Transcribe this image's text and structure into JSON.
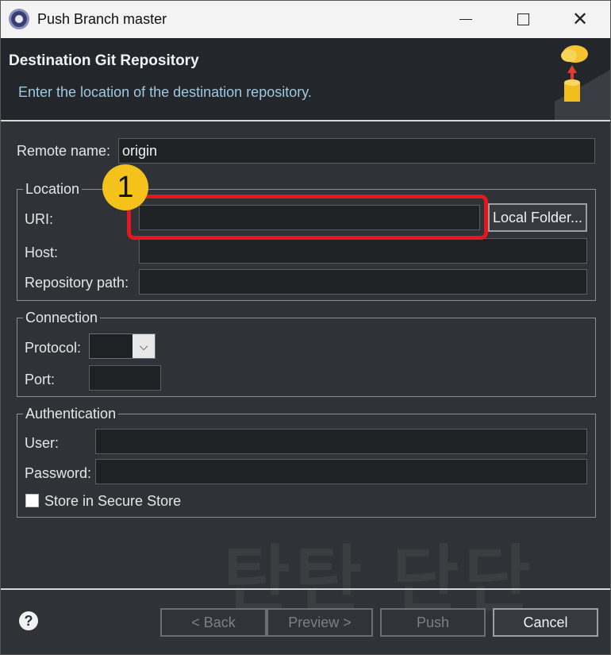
{
  "window": {
    "title": "Push Branch master",
    "minimize_icon": "minimize-icon",
    "maximize_icon": "maximize-icon",
    "close_glyph": "✕"
  },
  "banner": {
    "title": "Destination Git Repository",
    "description": "Enter the location of the destination repository."
  },
  "form": {
    "remote_name_label": "Remote name:",
    "remote_name_value": "origin"
  },
  "location": {
    "legend": "Location",
    "uri_label": "URI:",
    "uri_value": "",
    "local_folder_button": "Local Folder...",
    "host_label": "Host:",
    "host_value": "",
    "repo_path_label": "Repository path:",
    "repo_path_value": ""
  },
  "connection": {
    "legend": "Connection",
    "protocol_label": "Protocol:",
    "protocol_value": "",
    "port_label": "Port:",
    "port_value": ""
  },
  "authentication": {
    "legend": "Authentication",
    "user_label": "User:",
    "user_value": "",
    "password_label": "Password:",
    "password_value": "",
    "store_checkbox_label": "Store in Secure Store",
    "store_checked": false
  },
  "footer": {
    "help_glyph": "?",
    "back_button": "< Back",
    "preview_button": "Preview >",
    "push_button": "Push",
    "cancel_button": "Cancel"
  },
  "annotation": {
    "badge_number": "1",
    "highlight_color": "#e2171f",
    "badge_color": "#f4c21b"
  },
  "watermark": "탄탄 단단"
}
